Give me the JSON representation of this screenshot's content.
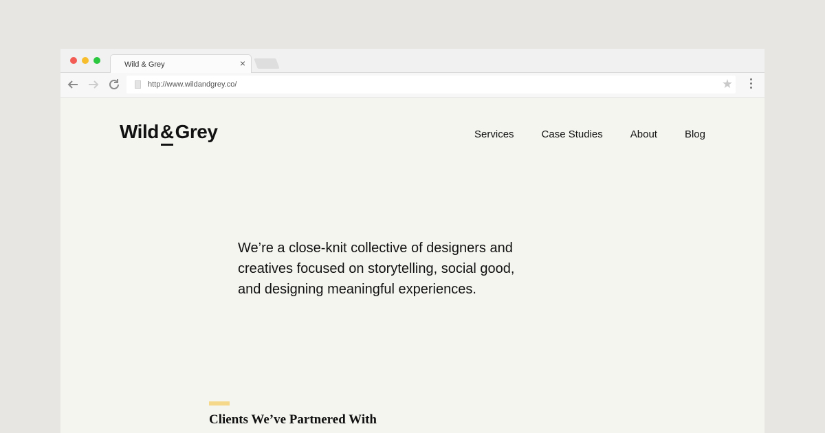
{
  "browser": {
    "tab_title": "Wild & Grey",
    "tab_close": "×",
    "url": "http://www.wildandgrey.co/",
    "icons": {
      "back": "arrow-left-icon",
      "forward": "arrow-right-icon",
      "reload": "reload-icon",
      "star": "star-icon",
      "menu": "kebab-menu-icon"
    },
    "traffic_lights": [
      "#f25c54",
      "#f7bd2c",
      "#2ac73f"
    ]
  },
  "site": {
    "logo_left": "Wild",
    "logo_amp": "&",
    "logo_right": "Grey",
    "nav": [
      "Services",
      "Case Studies",
      "About",
      "Blog"
    ],
    "intro": "We’re a close-knit collective of designers and creatives focused on storytelling, social good, and designing meaningful experiences.",
    "clients_heading": "Clients We’ve Partnered With",
    "accent_color": "#f6d88a"
  }
}
